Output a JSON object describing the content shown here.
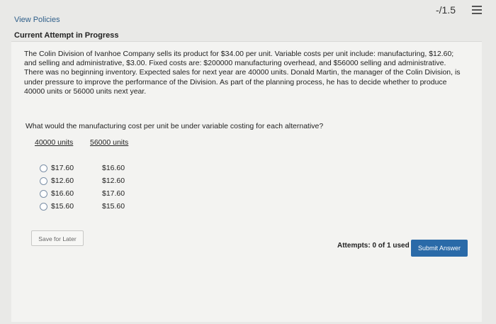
{
  "header": {
    "score": "-/1.5",
    "menu_icon": "list-icon"
  },
  "links": {
    "view_policies": "View Policies"
  },
  "attempt": {
    "title": "Current Attempt in Progress"
  },
  "question": {
    "text": "The Colin Division of Ivanhoe Company sells its product for $34.00 per unit. Variable costs per unit include: manufacturing, $12.60; and selling and administrative, $3.00. Fixed costs are: $200000 manufacturing overhead, and $56000 selling and administrative. There was no beginning inventory. Expected sales for next year are 40000 units. Donald Martin, the manager of the Colin Division, is under pressure to improve the performance of the Division. As part of the planning process, he has to decide whether to produce 40000 units or 56000 units next year.",
    "prompt": "What would the manufacturing cost per unit be under variable costing for each alternative?",
    "columns": [
      "40000 units",
      "56000 units"
    ],
    "options": [
      {
        "a": "$17.60",
        "b": "$16.60"
      },
      {
        "a": "$12.60",
        "b": "$12.60"
      },
      {
        "a": "$16.60",
        "b": "$17.60"
      },
      {
        "a": "$15.60",
        "b": "$15.60"
      }
    ]
  },
  "footer": {
    "save_label": "Save for Later",
    "attempts_text": "Attempts: 0 of 1 used",
    "submit_label": "Submit Answer"
  },
  "colors": {
    "accent": "#2a6aa8",
    "link": "#2f5f8a"
  }
}
